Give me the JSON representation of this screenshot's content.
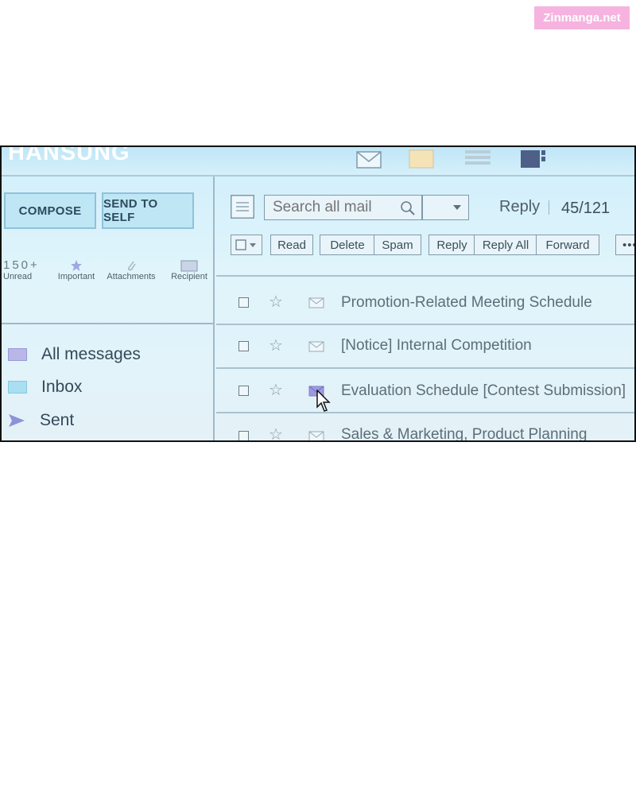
{
  "watermark": "Zinmanga.net",
  "brand": "HANSUNG",
  "sidebar": {
    "compose_label": "COMPOSE",
    "send_to_self_label": "SEND TO SELF",
    "stats": [
      {
        "value": "150+",
        "label": "Unread"
      },
      {
        "value": "",
        "label": "Important",
        "icon": "star-icon"
      },
      {
        "value": "",
        "label": "Attachments",
        "icon": "paperclip-icon"
      },
      {
        "value": "",
        "label": "Recipient",
        "icon": "recipient-icon"
      }
    ],
    "folders": [
      {
        "label": "All messages",
        "icon": "all-messages-icon",
        "color": "#b8b7e8"
      },
      {
        "label": "Inbox",
        "icon": "inbox-icon",
        "color": "#a9dff1"
      },
      {
        "label": "Sent",
        "icon": "sent-icon",
        "color": "#8c93d8"
      }
    ]
  },
  "search": {
    "placeholder": "Search all mail"
  },
  "header": {
    "reply_label": "Reply",
    "count": "45/121"
  },
  "toolbar": {
    "read": "Read",
    "delete": "Delete",
    "spam": "Spam",
    "reply": "Reply",
    "reply_all": "Reply All",
    "forward": "Forward",
    "more": "•••"
  },
  "emails": [
    {
      "subject": "Promotion-Related Meeting Schedule"
    },
    {
      "subject": "[Notice] Internal Competition"
    },
    {
      "subject": "Evaluation Schedule  [Contest Submission]"
    },
    {
      "subject": "Sales & Marketing, Product Planning"
    }
  ],
  "colors": {
    "accent": "#bfe6f5",
    "panel": "#dff4fb",
    "border": "#7f9aab"
  }
}
